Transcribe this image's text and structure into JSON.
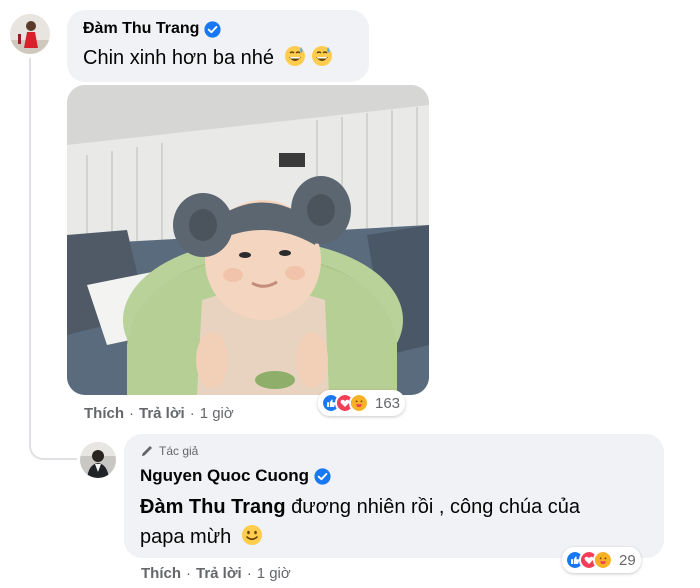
{
  "comment1": {
    "author": "Đàm Thu Trang",
    "text": "Chin xinh hơn ba nhé",
    "emojis": [
      "grinning-sweat-emoji",
      "grinning-sweat-emoji"
    ],
    "actions": {
      "like": "Thích",
      "reply": "Trả lời",
      "time": "1 giờ"
    },
    "reaction_icons": [
      "like",
      "love",
      "care"
    ],
    "reaction_count": "163"
  },
  "reply1": {
    "badge": "Tác giả",
    "author": "Nguyen Quoc Cuong",
    "tag": "Đàm Thu Trang",
    "text_line1": " đương nhiên rồi , công chúa của",
    "text_line2": "papa mừh",
    "emoji": "slightly-smiling-emoji",
    "actions": {
      "like": "Thích",
      "reply": "Trả lời",
      "time": "1 giờ"
    },
    "reaction_icons": [
      "like",
      "love",
      "care"
    ],
    "reaction_count": "29"
  },
  "separator": "·",
  "colors": {
    "bubble": "#f0f2f5",
    "verified": "#1877f2",
    "meta": "#65676b",
    "like": "#1877f2",
    "love": "#f33e58",
    "care": "#f7b125"
  }
}
